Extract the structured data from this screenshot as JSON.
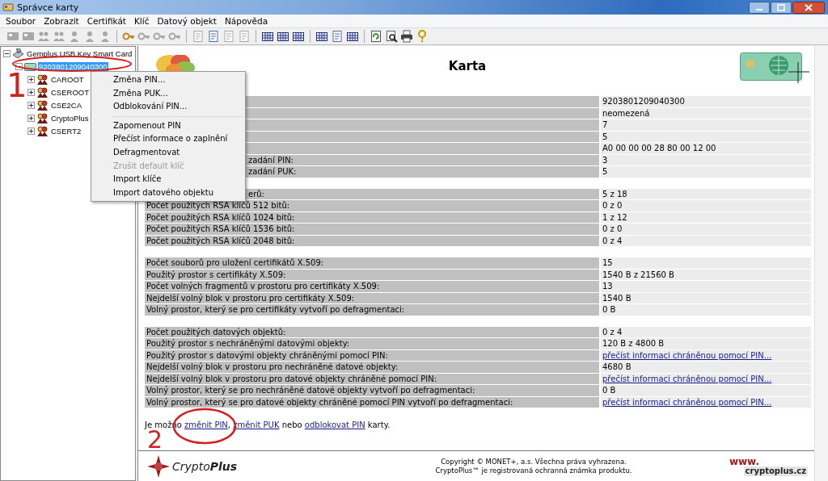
{
  "window": {
    "title": "Správce karty"
  },
  "menu_bar": [
    "Soubor",
    "Zobrazit",
    "Certifikát",
    "Klíč",
    "Datový objekt",
    "Nápověda"
  ],
  "toolbar": [
    [
      {
        "kind": "card",
        "disabled": true
      },
      {
        "kind": "card",
        "disabled": true
      },
      {
        "kind": "people",
        "disabled": true
      },
      {
        "kind": "people",
        "disabled": true
      },
      {
        "kind": "person",
        "disabled": true
      },
      {
        "kind": "person",
        "disabled": true
      },
      {
        "kind": "person",
        "disabled": true
      }
    ],
    [
      {
        "kind": "key",
        "disabled": false
      },
      {
        "kind": "key",
        "disabled": true
      },
      {
        "kind": "key",
        "disabled": true
      },
      {
        "kind": "key",
        "disabled": true
      }
    ],
    [
      {
        "kind": "doc",
        "disabled": true
      },
      {
        "kind": "doc",
        "disabled": false
      },
      {
        "kind": "doc",
        "disabled": true
      },
      {
        "kind": "doc",
        "disabled": true
      }
    ],
    [
      {
        "kind": "grid",
        "disabled": false
      },
      {
        "kind": "grid",
        "disabled": false
      },
      {
        "kind": "grid",
        "disabled": false
      }
    ],
    [
      {
        "kind": "grid",
        "disabled": false
      },
      {
        "kind": "doc",
        "disabled": false
      },
      {
        "kind": "grid",
        "disabled": false
      }
    ],
    [
      {
        "kind": "refresh",
        "disabled": false
      },
      {
        "kind": "find",
        "disabled": false
      },
      {
        "kind": "print",
        "disabled": false
      },
      {
        "kind": "help",
        "disabled": false
      }
    ]
  ],
  "tree": [
    {
      "label": "Gemplus USB Key Smart Card",
      "kind": "reader",
      "expanded": true,
      "selected": false,
      "children": [
        {
          "label": "9203801209040300",
          "kind": "card",
          "expanded": true,
          "selected": true,
          "children": [
            {
              "label": "CAROOT",
              "kind": "cert",
              "expanded": false,
              "selected": false
            },
            {
              "label": "CSEROOT",
              "kind": "cert",
              "expanded": false,
              "selected": false
            },
            {
              "label": "CSE2CA",
              "kind": "cert",
              "expanded": false,
              "selected": false
            },
            {
              "label": "CryptoPlus",
              "kind": "cert",
              "expanded": false,
              "selected": false
            },
            {
              "label": "CSERT2",
              "kind": "cert",
              "expanded": false,
              "selected": false
            }
          ]
        }
      ]
    }
  ],
  "context_menu": [
    {
      "kind": "item",
      "label": "Změna PIN...",
      "disabled": false
    },
    {
      "kind": "item",
      "label": "Změna PUK...",
      "disabled": false
    },
    {
      "kind": "item",
      "label": "Odblokování PIN...",
      "disabled": false
    },
    {
      "kind": "separator"
    },
    {
      "kind": "item",
      "label": "Zapomenout PIN",
      "disabled": false
    },
    {
      "kind": "item",
      "label": "Přečíst informace o zaplnění",
      "disabled": false
    },
    {
      "kind": "item",
      "label": "Defragmentovat",
      "disabled": false
    },
    {
      "kind": "item",
      "label": "Zrušit default klíč",
      "disabled": true
    },
    {
      "kind": "item",
      "label": "Import klíče",
      "disabled": false
    },
    {
      "kind": "item",
      "label": "Import datového objektu",
      "disabled": false
    }
  ],
  "page": {
    "title": "Karta",
    "groups": [
      [
        {
          "kind": "text",
          "value": "9203801209040300"
        },
        {
          "kind": "text",
          "value": "neomezená"
        },
        {
          "kind": "text",
          "value": "7"
        },
        {
          "kind": "text",
          "value": "5"
        },
        {
          "kind": "text",
          "value": "A0 00 00 00 28 80 00 12 00"
        },
        {
          "kind": "text",
          "label": "zadání PIN:",
          "value": "3"
        },
        {
          "kind": "text",
          "label": "zadání PUK:",
          "value": "5"
        }
      ],
      [
        {
          "kind": "text",
          "label": "erů:",
          "value": "5 z 18"
        },
        {
          "kind": "text",
          "label": "Počet použitých RSA klíčů 512 bitů:",
          "value": "0 z 0"
        },
        {
          "kind": "text",
          "label": "Počet použitých RSA klíčů 1024 bitů:",
          "value": "1 z 12"
        },
        {
          "kind": "text",
          "label": "Počet použitých RSA klíčů 1536 bitů:",
          "value": "0 z 0"
        },
        {
          "kind": "text",
          "label": "Počet použitých RSA klíčů 2048 bitů:",
          "value": "0 z 4"
        }
      ],
      [
        {
          "kind": "text",
          "label": "Počet souborů pro uložení certifikátů X.509:",
          "value": "15"
        },
        {
          "kind": "text",
          "label": "Použitý prostor s certifikáty X.509:",
          "value": "1540 B z 21560 B"
        },
        {
          "kind": "text",
          "label": "Počet volných fragmentů v prostoru pro certifikáty X.509:",
          "value": "13"
        },
        {
          "kind": "text",
          "label": "Nejdelší volný blok v prostoru pro certifikáty X.509:",
          "value": "1540 B"
        },
        {
          "kind": "text",
          "label": "Volný prostor, který se pro certifikáty vytvoří po defragmentaci:",
          "value": "0 B"
        }
      ],
      [
        {
          "kind": "text",
          "label": "Počet použitých datových objektů:",
          "value": "0 z 4"
        },
        {
          "kind": "text",
          "label": "Použitý prostor s nechráněnými datovými objekty:",
          "value": "120 B z 4800 B"
        },
        {
          "kind": "link",
          "label": "Použitý prostor s datovými objekty chráněnými pomocí PIN:",
          "value": "přečíst informaci chráněnou pomocí PIN..."
        },
        {
          "kind": "text",
          "label": "Nejdelší volný blok v prostoru pro nechráněné datové objekty:",
          "value": "4680 B"
        },
        {
          "kind": "link",
          "label": "Nejdelší volný blok v prostoru pro datové objekty chráněné pomocí PIN:",
          "value": "přečíst informaci chráněnou pomocí PIN..."
        },
        {
          "kind": "text",
          "label": "Volný prostor, který se pro nechráněné datové objekty vytvoří po defragmentaci:",
          "value": "0 B"
        },
        {
          "kind": "link",
          "label": "Volný prostor, který se pro datové objekty chráněné pomocí PIN vytvoří po defragmentaci:",
          "value": "přečíst informaci chráněnou pomocí PIN..."
        }
      ]
    ],
    "sentence": [
      {
        "kind": "text",
        "text": "Je možno "
      },
      {
        "kind": "link",
        "text": "změnit PIN"
      },
      {
        "kind": "text",
        "text": ", "
      },
      {
        "kind": "link",
        "text": "změnit PUK"
      },
      {
        "kind": "text",
        "text": " nebo "
      },
      {
        "kind": "link",
        "text": "odblokovat PIN"
      },
      {
        "kind": "text",
        "text": " karty."
      }
    ],
    "footer": {
      "logo": "Crypto**Plus**",
      "copyright": [
        "Copyright © MONET+, a.s. Všechna práva vyhrazena.",
        "CryptoPlus™ je registrovaná ochranná známka produktu."
      ],
      "web_prefix": "www.",
      "web_domain": "cryptoplus.cz"
    }
  },
  "annotations": [
    {
      "label": "1"
    },
    {
      "label": "2"
    }
  ]
}
